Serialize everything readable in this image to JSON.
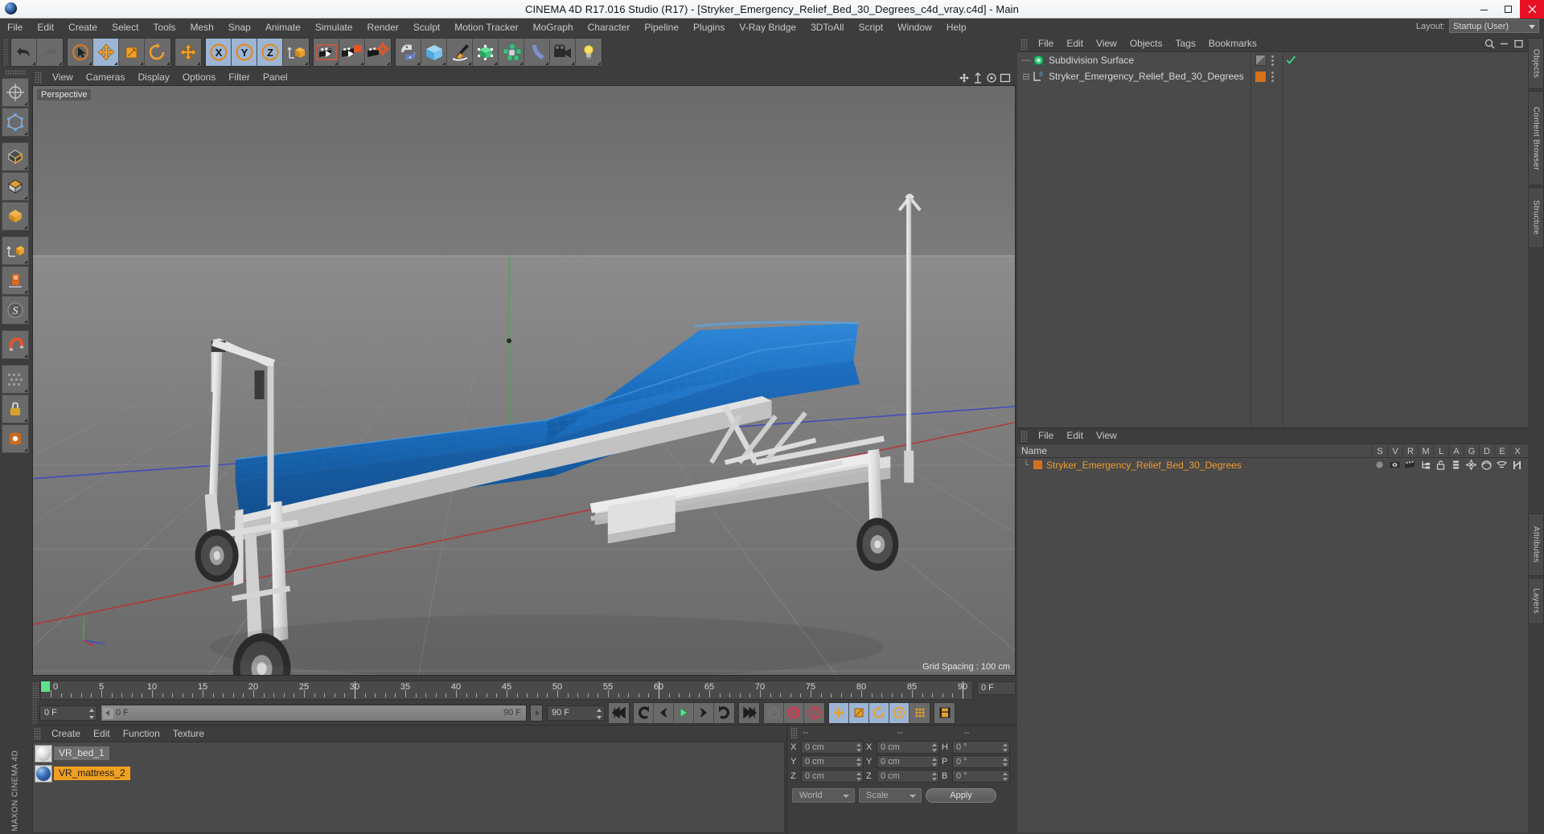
{
  "window": {
    "title": "CINEMA 4D R17.016 Studio (R17) - [Stryker_Emergency_Relief_Bed_30_Degrees_c4d_vray.c4d] - Main",
    "minimize": "–",
    "maximize": "☐",
    "close": "✕"
  },
  "menubar": {
    "items": [
      {
        "label": "File"
      },
      {
        "label": "Edit"
      },
      {
        "label": "Create"
      },
      {
        "label": "Select"
      },
      {
        "label": "Tools"
      },
      {
        "label": "Mesh"
      },
      {
        "label": "Snap"
      },
      {
        "label": "Animate"
      },
      {
        "label": "Simulate"
      },
      {
        "label": "Render"
      },
      {
        "label": "Sculpt"
      },
      {
        "label": "Motion Tracker"
      },
      {
        "label": "MoGraph"
      },
      {
        "label": "Character"
      },
      {
        "label": "Pipeline"
      },
      {
        "label": "Plugins"
      },
      {
        "label": "V-Ray Bridge"
      },
      {
        "label": "3DToAll"
      },
      {
        "label": "Script"
      },
      {
        "label": "Window"
      },
      {
        "label": "Help"
      }
    ],
    "layout_label": "Layout:",
    "layout_value": "Startup (User)"
  },
  "toolbar": {
    "groups": [
      {
        "name": "history",
        "buttons": [
          {
            "icon": "undo-icon",
            "label": "Undo",
            "state": "normal"
          },
          {
            "icon": "redo-icon",
            "label": "Redo",
            "state": "disabled"
          }
        ]
      },
      {
        "name": "modes",
        "buttons": [
          {
            "icon": "live-selection-icon",
            "label": "Live Selection",
            "state": "normal"
          },
          {
            "icon": "move-icon",
            "label": "Move",
            "state": "active"
          },
          {
            "icon": "scale-icon",
            "label": "Scale",
            "state": "normal"
          },
          {
            "icon": "rotate-icon",
            "label": "Rotate",
            "state": "normal"
          }
        ]
      },
      {
        "name": "mousebutton",
        "buttons": [
          {
            "icon": "move-axis-icon",
            "label": "Mouse Function",
            "state": "normal"
          }
        ]
      },
      {
        "name": "axislock",
        "buttons": [
          {
            "icon": "x-axis-icon",
            "label": "X Axis",
            "state": "active"
          },
          {
            "icon": "y-axis-icon",
            "label": "Y Axis",
            "state": "active"
          },
          {
            "icon": "z-axis-icon",
            "label": "Z Axis",
            "state": "active"
          },
          {
            "icon": "world-object-coord-icon",
            "label": "World/Object Coordinate System",
            "state": "normal"
          }
        ]
      },
      {
        "name": "render",
        "buttons": [
          {
            "icon": "render-view-icon",
            "label": "Render View",
            "state": "normal"
          },
          {
            "icon": "render-region-icon",
            "label": "Render to Picture Viewer",
            "state": "normal"
          },
          {
            "icon": "render-settings-icon",
            "label": "Edit Render Settings",
            "state": "normal"
          }
        ]
      },
      {
        "name": "create",
        "buttons": [
          {
            "icon": "python-icon",
            "label": "Python",
            "state": "normal"
          },
          {
            "icon": "cube-primitive-icon",
            "label": "Add Cube Object",
            "state": "normal"
          },
          {
            "icon": "spline-pen-icon",
            "label": "Add Spline Object",
            "state": "normal"
          },
          {
            "icon": "nurbs-cube-icon",
            "label": "Add Generator Object",
            "state": "normal"
          },
          {
            "icon": "array-icon",
            "label": "Add Array Object",
            "state": "normal"
          },
          {
            "icon": "bend-deformer-icon",
            "label": "Add Bend Object",
            "state": "normal"
          },
          {
            "icon": "camera-icon",
            "label": "Add Camera Object",
            "state": "normal"
          },
          {
            "icon": "light-icon",
            "label": "Add Light Object",
            "state": "normal"
          }
        ]
      }
    ]
  },
  "left_palette": {
    "buttons": [
      {
        "icon": "axis-move-icon",
        "label": "Move Axis"
      },
      {
        "icon": "point-mode-icon",
        "label": "Point Mode"
      },
      {
        "icon": "edge-mode-icon",
        "label": "Edge Mode"
      },
      {
        "icon": "polygon-mode-icon",
        "label": "Polygon Mode"
      },
      {
        "icon": "model-mode-icon",
        "label": "Model Mode"
      },
      {
        "icon": "object-mode-icon",
        "label": "Object Mode"
      },
      {
        "icon": "texture-mode-icon",
        "label": "Texture Mode"
      },
      {
        "icon": "workplane-icon",
        "label": "Workplane"
      },
      {
        "icon": "enable-axis-icon",
        "label": "Enable Axis Modification"
      },
      {
        "icon": "subdivision-s-icon",
        "label": "Use Subdivision"
      },
      {
        "icon": "magnet-icon",
        "label": "Magnet Tool"
      },
      {
        "icon": "viewport-solo-icon",
        "label": "Viewport Solo"
      },
      {
        "icon": "lock-icon",
        "label": "Lock Workplane"
      },
      {
        "icon": "snap-icon",
        "label": "Enable Snapping"
      }
    ]
  },
  "viewport": {
    "menu": [
      {
        "label": "View"
      },
      {
        "label": "Cameras"
      },
      {
        "label": "Display"
      },
      {
        "label": "Options"
      },
      {
        "label": "Filter"
      },
      {
        "label": "Panel"
      }
    ],
    "camera_label": "Perspective",
    "grid_spacing": "Grid Spacing : 100 cm",
    "axis_gizmo": {
      "y": "Y",
      "x": "X",
      "z": "Z"
    },
    "scene_description": "White hospital emergency relief stretcher bed with blue mattress raised 30 degrees, four casters and an IV pole",
    "colors": {
      "mattress": "#1f78c8",
      "frame": "#e8e8e8",
      "x_axis": "#c23030",
      "y_axis": "#36a02e",
      "z_axis": "#3b49c4",
      "background_top": "#6e6e6e",
      "background_bottom": "#6d6d6d"
    }
  },
  "timeline": {
    "start_label": "0",
    "ticks": [
      "0",
      "5",
      "10",
      "15",
      "20",
      "25",
      "30",
      "35",
      "40",
      "45",
      "50",
      "55",
      "60",
      "65",
      "70",
      "75",
      "80",
      "85",
      "90"
    ],
    "current_frame_field": "0 F",
    "range_start": "0 F",
    "range_end": "90 F",
    "frame_field": "0 F",
    "end_field": "90 F"
  },
  "transport": {
    "buttons": [
      {
        "icon": "go-to-start-icon",
        "label": "Go to Start"
      },
      {
        "icon": "previous-key-icon",
        "label": "Go to Previous Key"
      },
      {
        "icon": "previous-frame-icon",
        "label": "Go to Previous Frame"
      },
      {
        "icon": "play-forwards-icon",
        "label": "Play Forwards"
      },
      {
        "icon": "next-frame-icon",
        "label": "Go to Next Frame"
      },
      {
        "icon": "next-key-icon",
        "label": "Go to Next Key"
      },
      {
        "icon": "go-to-end-icon",
        "label": "Go to End"
      },
      {
        "icon": "record-active-objects-icon",
        "label": "Record Active Objects"
      },
      {
        "icon": "autokeying-icon",
        "label": "Autokeying"
      },
      {
        "icon": "keyframe-selection-icon",
        "label": "Keyframe Selection"
      },
      {
        "icon": "position-key-icon",
        "label": "Position"
      },
      {
        "icon": "scale-key-icon",
        "label": "Scale"
      },
      {
        "icon": "rotation-key-icon",
        "label": "Rotation"
      },
      {
        "icon": "parameter-key-icon",
        "label": "Parameter"
      },
      {
        "icon": "point-level-anim-icon",
        "label": "Point Level Animation"
      },
      {
        "icon": "timeline-icon",
        "label": "Timeline"
      }
    ]
  },
  "material_manager": {
    "menu": [
      {
        "label": "Create"
      },
      {
        "label": "Edit"
      },
      {
        "label": "Function"
      },
      {
        "label": "Texture"
      }
    ],
    "materials": [
      {
        "name": "VR_bed_1",
        "preview": "white-sphere-icon",
        "selected": "grey"
      },
      {
        "name": "VR_mattress_2",
        "preview": "blue-sphere-icon",
        "selected": "orange"
      }
    ]
  },
  "coordinates": {
    "header": [
      "--",
      "--",
      "--"
    ],
    "rows": [
      {
        "label_pos": "X",
        "value_pos": "0 cm",
        "label_size": "X",
        "value_size": "0 cm",
        "label_rot": "H",
        "value_rot": "0 °"
      },
      {
        "label_pos": "Y",
        "value_pos": "0 cm",
        "label_size": "Y",
        "value_size": "0 cm",
        "label_rot": "P",
        "value_rot": "0 °"
      },
      {
        "label_pos": "Z",
        "value_pos": "0 cm",
        "label_size": "Z",
        "value_size": "0 cm",
        "label_rot": "B",
        "value_rot": "0 °"
      }
    ],
    "system_select": "World",
    "mode_select": "Scale",
    "apply_button": "Apply"
  },
  "object_manager": {
    "menu": [
      {
        "label": "File"
      },
      {
        "label": "Edit"
      },
      {
        "label": "View"
      },
      {
        "label": "Objects"
      },
      {
        "label": "Tags"
      },
      {
        "label": "Bookmarks"
      }
    ],
    "rows": [
      {
        "name": "Subdivision Surface",
        "icon": "subdivision-surface-icon",
        "tree": "—",
        "tag_swatch": "none",
        "has_check": true
      },
      {
        "name": "Stryker_Emergency_Relief_Bed_30_Degrees",
        "icon": "null-object-icon",
        "tree": "⊟",
        "tag_swatch": "#d4711f",
        "has_check": false
      }
    ]
  },
  "lower_manager": {
    "menu": [
      {
        "label": "File"
      },
      {
        "label": "Edit"
      },
      {
        "label": "View"
      }
    ],
    "name_header": "Name",
    "columns": [
      "S",
      "V",
      "R",
      "M",
      "L",
      "A",
      "G",
      "D",
      "E",
      "X"
    ],
    "rows": [
      {
        "name": "Stryker_Emergency_Relief_Bed_30_Degrees",
        "swatch": "#d4711f",
        "icons": [
          "dot-icon",
          "visible-editor-icon",
          "visible-render-icon",
          "hierarchy-icon",
          "unlock-icon",
          "layer-icon",
          "generator-icon",
          "deformer-icon",
          "expression-icon",
          "xref-icon"
        ]
      }
    ]
  },
  "right_tabs": [
    {
      "label": "Objects"
    },
    {
      "label": "Content Browser"
    },
    {
      "label": "Structure"
    },
    {
      "label": "Attributes"
    },
    {
      "label": "Layers"
    }
  ],
  "branding": {
    "text": "MAXON CINEMA 4D"
  }
}
